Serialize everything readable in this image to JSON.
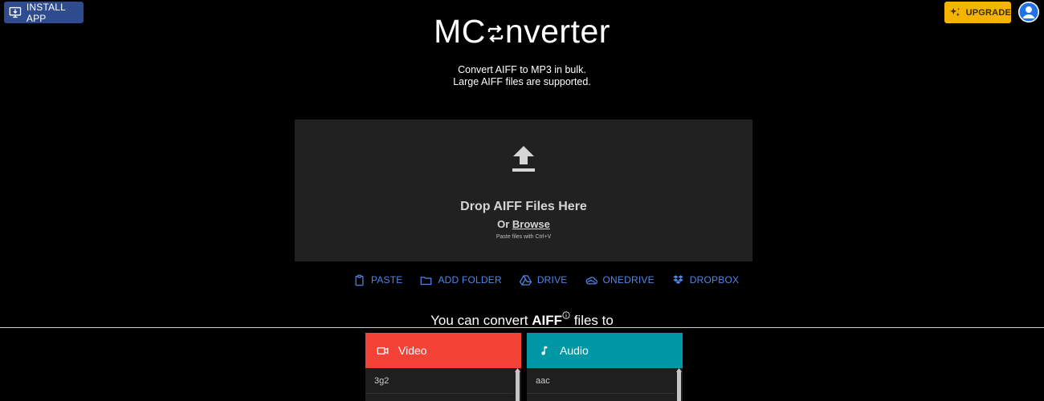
{
  "header": {
    "install_label": "INSTALL APP",
    "upgrade_label": "UPGRADE",
    "logo_text_left": "MC",
    "logo_text_right": "nverter"
  },
  "tagline": {
    "line1": "Convert AIFF to MP3 in bulk.",
    "line2": "Large AIFF files are supported."
  },
  "dropzone": {
    "title": "Drop AIFF Files Here",
    "or_text": "Or",
    "browse_label": "Browse",
    "hint": "Paste files with Ctrl+V"
  },
  "sources": [
    {
      "label": "PASTE",
      "icon": "clipboard-icon"
    },
    {
      "label": "ADD FOLDER",
      "icon": "folder-icon"
    },
    {
      "label": "DRIVE",
      "icon": "google-drive-icon"
    },
    {
      "label": "ONEDRIVE",
      "icon": "onedrive-icon"
    },
    {
      "label": "DROPBOX",
      "icon": "dropbox-icon"
    }
  ],
  "convert_line": {
    "prefix": "You can convert",
    "format": "AIFF",
    "suffix": "files to"
  },
  "categories": [
    {
      "label": "Video",
      "icon": "video-camera-icon",
      "color": "#f44336",
      "first_item": "3g2"
    },
    {
      "label": "Audio",
      "icon": "music-note-icon",
      "color": "#0097a7",
      "first_item": "aac"
    }
  ],
  "colors": {
    "install_bg": "#2f4d8e",
    "upgrade_bg": "#f5b400",
    "link_blue": "#4f86e8",
    "dropzone_bg": "#212121"
  }
}
